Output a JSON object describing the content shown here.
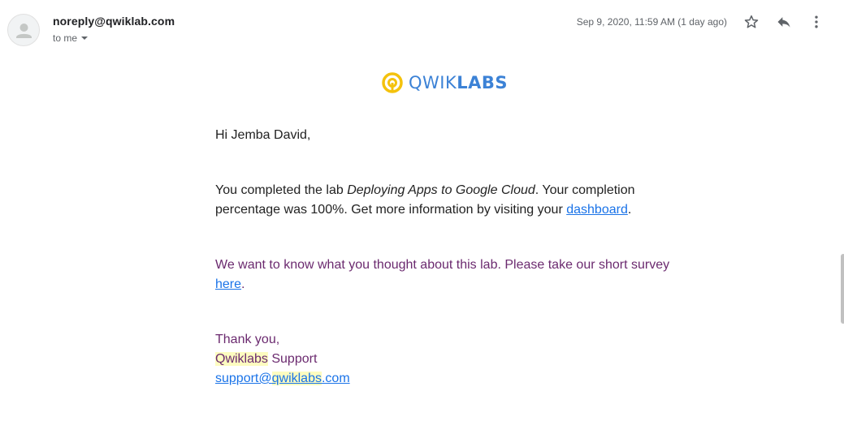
{
  "header": {
    "sender": "noreply@qwiklab.com",
    "recipient_label": "to me",
    "date": "Sep 9, 2020, 11:59 AM (1 day ago)"
  },
  "icons": {
    "avatar": "person-icon",
    "star": "star-icon",
    "reply": "reply-icon",
    "more": "more-vert-icon",
    "dropdown": "caret-down-icon"
  },
  "logo": {
    "text_light": "QWIK",
    "text_bold": "LABS",
    "accent_color": "#f4c20d",
    "brand_color": "#3c82d6"
  },
  "email": {
    "greeting": "Hi Jemba David,",
    "para1_prefix": "You completed the lab ",
    "lab_name": "Deploying Apps to Google Cloud",
    "para1_middle": ". Your completion percentage was 100%. Get more information by visiting your ",
    "dashboard_link": "dashboard",
    "para1_suffix": ".",
    "para2_prefix": "We want to know what you thought about this lab. Please take our short survey ",
    "survey_link": "here",
    "para2_suffix": ".",
    "thanks": "Thank you,",
    "signature_brand": "Qwiklabs",
    "signature_team": " Support",
    "support_email_prefix": "support@",
    "support_email_brand": "qwiklabs",
    "support_email_suffix": ".com"
  }
}
